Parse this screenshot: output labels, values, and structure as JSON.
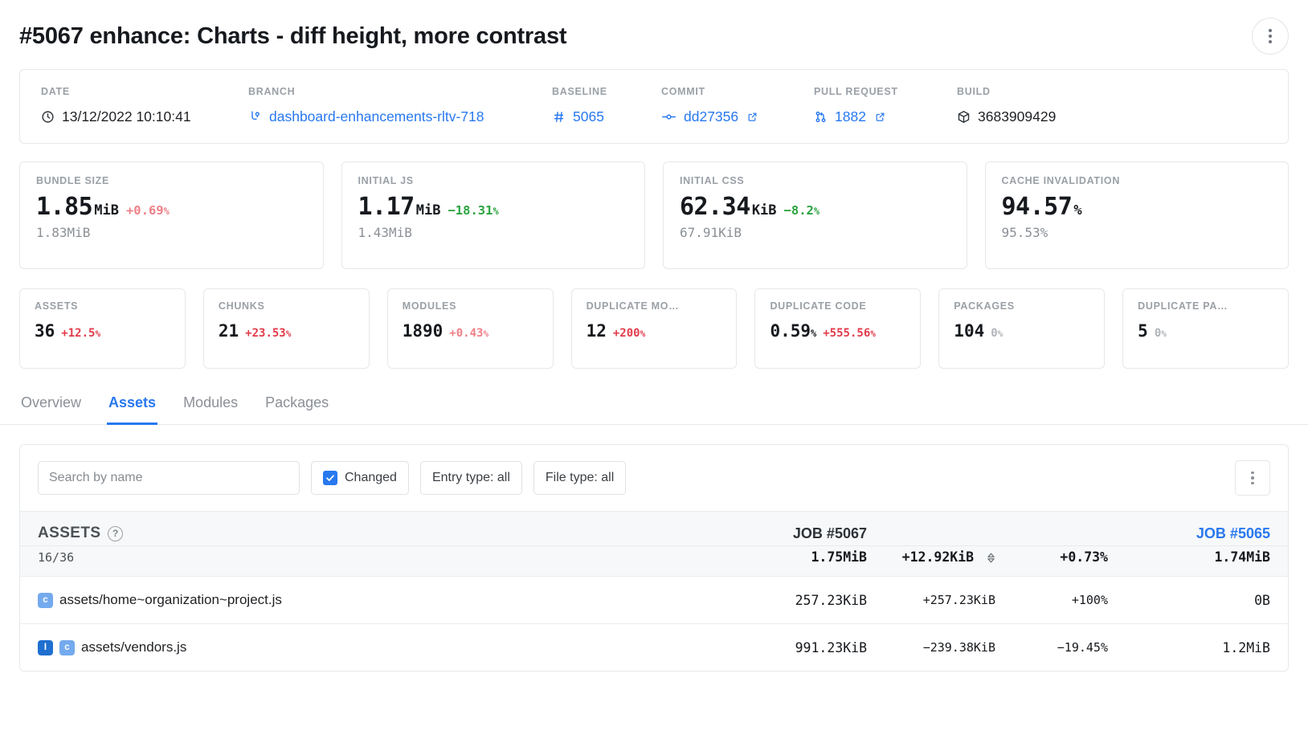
{
  "header": {
    "title": "#5067 enhance: Charts - diff height, more contrast",
    "menu_icon": "kebab-menu-icon"
  },
  "meta": {
    "fields": [
      {
        "label": "DATE",
        "value": "13/12/2022 10:10:41",
        "icon": "clock-icon",
        "link": false,
        "external": false
      },
      {
        "label": "BRANCH",
        "value": "dashboard-enhancements-rltv-718",
        "icon": "branch-icon",
        "link": true,
        "external": false
      },
      {
        "label": "BASELINE",
        "value": "5065",
        "icon": "hash-icon",
        "link": true,
        "external": false
      },
      {
        "label": "COMMIT",
        "value": "dd27356",
        "icon": "commit-icon",
        "link": true,
        "external": true
      },
      {
        "label": "PULL REQUEST",
        "value": "1882",
        "icon": "pull-request-icon",
        "link": true,
        "external": true
      },
      {
        "label": "BUILD",
        "value": "3683909429",
        "icon": "package-icon",
        "link": false,
        "external": false
      }
    ]
  },
  "metrics": [
    {
      "title": "BUNDLE SIZE",
      "value": "1.85",
      "unit": "MiB",
      "delta": "+0.69",
      "delta_suffix": "%",
      "delta_dir": "up-soft",
      "baseline": "1.83MiB"
    },
    {
      "title": "INITIAL JS",
      "value": "1.17",
      "unit": "MiB",
      "delta": "−18.31",
      "delta_suffix": "%",
      "delta_dir": "down-strong",
      "baseline": "1.43MiB"
    },
    {
      "title": "INITIAL CSS",
      "value": "62.34",
      "unit": "KiB",
      "delta": "−8.2",
      "delta_suffix": "%",
      "delta_dir": "down-strong",
      "baseline": "67.91KiB"
    },
    {
      "title": "CACHE INVALIDATION",
      "value": "94.57",
      "unit": "%",
      "delta": "",
      "delta_suffix": "",
      "delta_dir": "",
      "baseline": "95.53%"
    }
  ],
  "stats": [
    {
      "title": "ASSETS",
      "value": "36",
      "unit": "",
      "delta": "+12.5",
      "delta_suffix": "%",
      "delta_dir": "up-strong"
    },
    {
      "title": "CHUNKS",
      "value": "21",
      "unit": "",
      "delta": "+23.53",
      "delta_suffix": "%",
      "delta_dir": "up-strong"
    },
    {
      "title": "MODULES",
      "value": "1890",
      "unit": "",
      "delta": "+0.43",
      "delta_suffix": "%",
      "delta_dir": "up-soft"
    },
    {
      "title": "DUPLICATE MO…",
      "value": "12",
      "unit": "",
      "delta": "+200",
      "delta_suffix": "%",
      "delta_dir": "up-strong"
    },
    {
      "title": "DUPLICATE CODE",
      "value": "0.59",
      "unit": "%",
      "delta": "+555.56",
      "delta_suffix": "%",
      "delta_dir": "up-strong"
    },
    {
      "title": "PACKAGES",
      "value": "104",
      "unit": "",
      "delta": "0",
      "delta_suffix": "%",
      "delta_dir": "neutral"
    },
    {
      "title": "DUPLICATE PA…",
      "value": "5",
      "unit": "",
      "delta": "0",
      "delta_suffix": "%",
      "delta_dir": "neutral"
    }
  ],
  "tabs": [
    {
      "label": "Overview",
      "active": false
    },
    {
      "label": "Assets",
      "active": true
    },
    {
      "label": "Modules",
      "active": false
    },
    {
      "label": "Packages",
      "active": false
    }
  ],
  "filters": {
    "search_placeholder": "Search by name",
    "search_value": "",
    "changed_label": "Changed",
    "changed_checked": true,
    "entry_type_label": "Entry type: all",
    "file_type_label": "File type: all",
    "menu_icon": "kebab-menu-icon"
  },
  "table": {
    "group_title": "ASSETS",
    "group_help_icon": "question-mark-icon",
    "group_count": "16/36",
    "col_current_job": "JOB #5067",
    "col_baseline_job": "JOB #5065",
    "summary": {
      "current": "1.75MiB",
      "delta_abs": "+12.92KiB",
      "delta_pct": "+0.73%",
      "delta_dir": "up-soft",
      "baseline": "1.74MiB",
      "sort_icon": "sort-updown-icon"
    },
    "rows": [
      {
        "badges": [
          {
            "letter": "c",
            "kind": "b-chunk",
            "name": "chunk-badge"
          }
        ],
        "name": "assets/home~organization~project.js",
        "current": "257.23KiB",
        "delta_abs": "+257.23KiB",
        "delta_pct": "+100%",
        "delta_dir": "up-strong",
        "baseline": "0B"
      },
      {
        "badges": [
          {
            "letter": "I",
            "kind": "b-initial",
            "name": "initial-badge"
          },
          {
            "letter": "c",
            "kind": "b-chunk",
            "name": "chunk-badge"
          }
        ],
        "name": "assets/vendors.js",
        "current": "991.23KiB",
        "delta_abs": "−239.38KiB",
        "delta_pct": "−19.45%",
        "delta_dir": "down-strong",
        "baseline": "1.2MiB"
      }
    ]
  },
  "colors": {
    "accent": "#2878f0",
    "increase": "#e23b4a",
    "decrease": "#2aa33f",
    "neutral": "#b0b4b8",
    "muted": "#9aa0a6"
  }
}
